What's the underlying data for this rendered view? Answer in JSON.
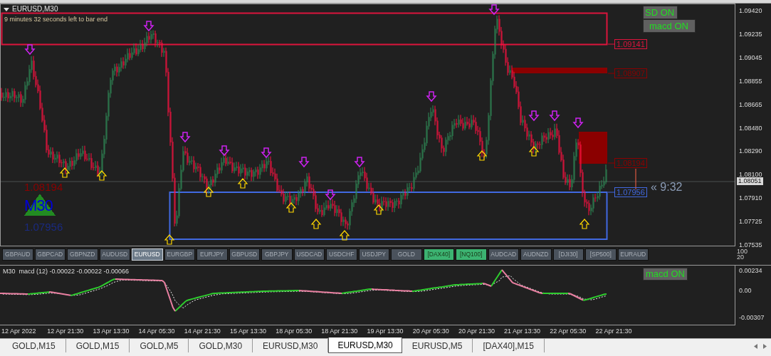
{
  "chart": {
    "symbol": "EURUSD,M30",
    "countdown": "9 minutes 32 seconds left to bar end",
    "toggles": [
      {
        "label": "SD ON"
      },
      {
        "label": "macd ON"
      }
    ],
    "price_axis": [
      "1.09420",
      "1.09235",
      "1.09045",
      "1.08855",
      "1.08665",
      "1.08480",
      "1.08290",
      "1.08100",
      "1.07910",
      "1.07725",
      "1.07535"
    ],
    "current_price": "1.08051",
    "zone_labels": [
      {
        "text": "1.09141",
        "color": "#dc143c"
      },
      {
        "text": "1.08907",
        "color": "#8b0000"
      },
      {
        "text": "1.08194",
        "color": "#8b0000"
      },
      {
        "text": "1.07956",
        "color": "#4169e1"
      }
    ],
    "timer": "« 9:32",
    "badge": {
      "upper": "1.08194",
      "timeframe": "M30",
      "lower": "1.07956"
    }
  },
  "symbols": [
    {
      "label": "GBPAUD",
      "selected": false,
      "highlighted": false
    },
    {
      "label": "GBPCAD",
      "selected": false,
      "highlighted": false
    },
    {
      "label": "GBPNZD",
      "selected": false,
      "highlighted": false
    },
    {
      "label": "AUDUSD",
      "selected": false,
      "highlighted": false
    },
    {
      "label": "EURUSD",
      "selected": true,
      "highlighted": false
    },
    {
      "label": "EURGBP",
      "selected": false,
      "highlighted": false
    },
    {
      "label": "EURJPY",
      "selected": false,
      "highlighted": false
    },
    {
      "label": "GBPUSD",
      "selected": false,
      "highlighted": false
    },
    {
      "label": "GBPJPY",
      "selected": false,
      "highlighted": false
    },
    {
      "label": "USDCAD",
      "selected": false,
      "highlighted": false
    },
    {
      "label": "USDCHF",
      "selected": false,
      "highlighted": false
    },
    {
      "label": "USDJPY",
      "selected": false,
      "highlighted": false
    },
    {
      "label": "GOLD",
      "selected": false,
      "highlighted": false
    },
    {
      "label": "[DAX40]",
      "selected": false,
      "highlighted": true
    },
    {
      "label": "[NQ100]",
      "selected": false,
      "highlighted": true
    },
    {
      "label": "AUDCAD",
      "selected": false,
      "highlighted": false
    },
    {
      "label": "AUDNZD",
      "selected": false,
      "highlighted": false
    },
    {
      "label": "[DJI30]",
      "selected": false,
      "highlighted": false
    },
    {
      "label": "[SP500]",
      "selected": false,
      "highlighted": false
    },
    {
      "label": "EURAUD",
      "selected": false,
      "highlighted": false
    }
  ],
  "row_axis": [
    "100",
    "20"
  ],
  "macd": {
    "title": "M30  macd (12) -0.00022 -0.00022 -0.00066",
    "toggle": "macd ON",
    "axis": [
      "0.00234",
      "0.00",
      "-0.00307"
    ]
  },
  "time_axis": [
    "12 Apr 2022",
    "12 Apr 21:30",
    "13 Apr 13:30",
    "14 Apr 05:30",
    "14 Apr 21:30",
    "15 Apr 13:30",
    "18 Apr 05:30",
    "18 Apr 21:30",
    "19 Apr 13:30",
    "20 Apr 05:30",
    "20 Apr 21:30",
    "21 Apr 13:30",
    "22 Apr 05:30",
    "22 Apr 21:30"
  ],
  "tabs": [
    {
      "label": "GOLD,M15",
      "selected": false
    },
    {
      "label": "GOLD,M15",
      "selected": false
    },
    {
      "label": "GOLD,M5",
      "selected": false
    },
    {
      "label": "GOLD,M30",
      "selected": false
    },
    {
      "label": "EURUSD,M30",
      "selected": false
    },
    {
      "label": "EURUSD,M30",
      "selected": true
    },
    {
      "label": "EURUSD,M5",
      "selected": false
    },
    {
      "label": "[DAX40],M15",
      "selected": false
    }
  ]
}
